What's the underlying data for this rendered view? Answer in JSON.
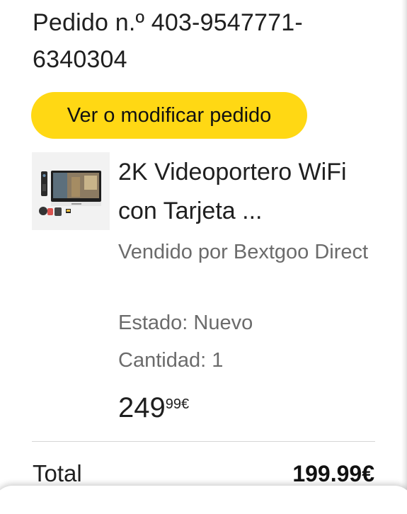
{
  "order": {
    "title": "Pedido n.º 403-9547771-6340304",
    "modify_button": "Ver o modificar pedido"
  },
  "product": {
    "name": "2K Videoportero WiFi con Tarjeta ...",
    "seller": "Vendido por Bextgoo Direct",
    "condition": "Estado: Nuevo",
    "quantity": "Cantidad: 1",
    "price_whole": "249",
    "price_fraction": "99€",
    "image_icon": "video-doorbell-kit-image"
  },
  "summary": {
    "total_label": "Total",
    "total_value": "199.99€"
  },
  "colors": {
    "button_yellow": "#ffd814",
    "muted_text": "#6b6b6b"
  }
}
